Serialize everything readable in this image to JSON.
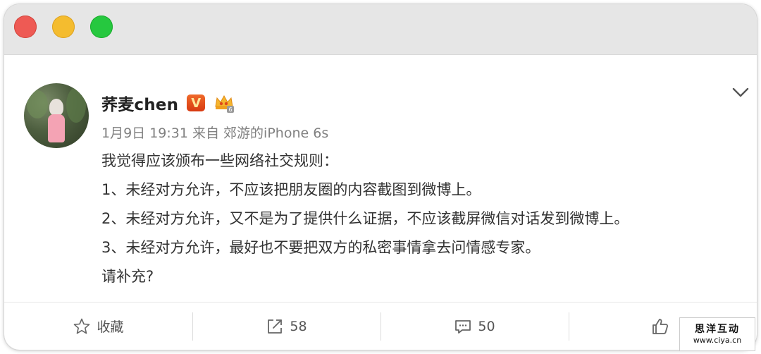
{
  "post": {
    "username": "荞麦chen",
    "vip_badge": "V",
    "meta": "1月9日 19:31 来自 郊游的iPhone 6s",
    "lines": [
      "我觉得应该颁布一些网络社交规则：",
      "1、未经对方允许，不应该把朋友圈的内容截图到微博上。",
      "2、未经对方允许，又不是为了提供什么证据，不应该截屏微信对话发到微博上。",
      "3、未经对方允许，最好也不要把双方的私密事情拿去问情感专家。",
      "请补充?"
    ]
  },
  "actions": {
    "favorite_label": "收藏",
    "repost_count": "58",
    "comment_count": "50",
    "like_count": ""
  },
  "watermark": {
    "title": "思洋互动",
    "url": "www.ciya.cn"
  },
  "colors": {
    "traffic_red": "#ee5a54",
    "traffic_yellow": "#f4bc2f",
    "traffic_green": "#26c83f",
    "vip_orange": "#e0481a"
  }
}
